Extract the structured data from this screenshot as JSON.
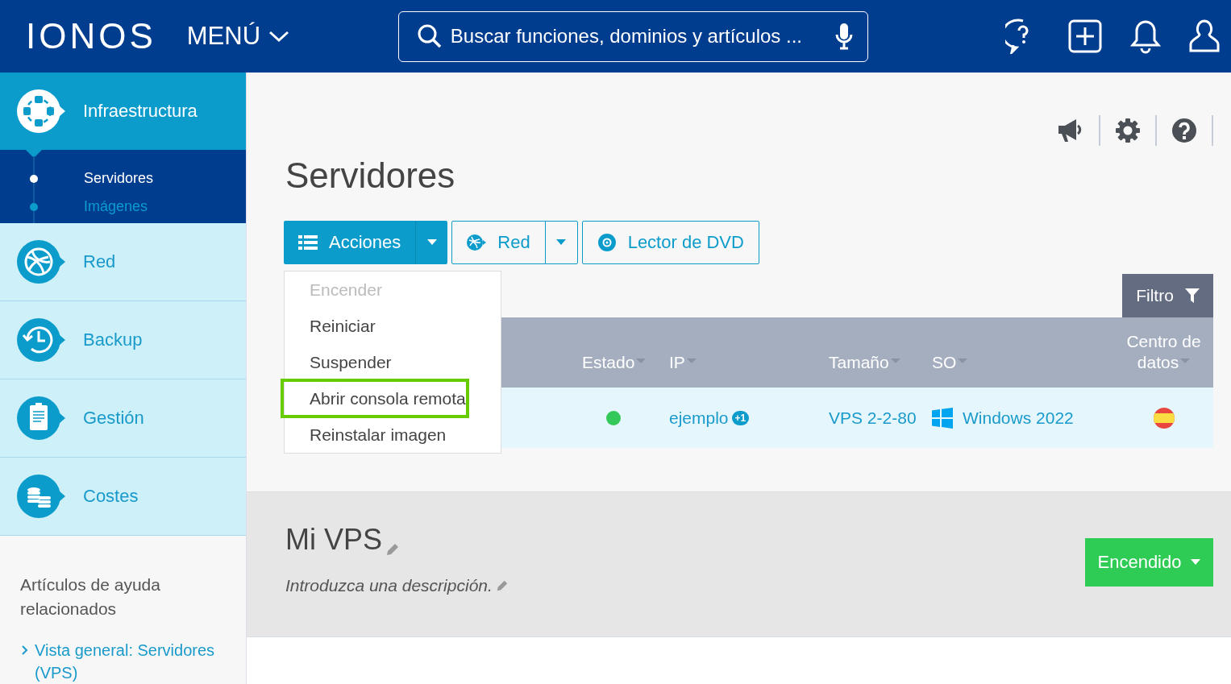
{
  "header": {
    "logo": "IONOS",
    "menu": "MENÚ",
    "search": {
      "placeholder": "Buscar funciones, dominios y artículos ..."
    }
  },
  "sidebar": {
    "items": [
      {
        "label": "Infraestructura",
        "selected": true,
        "children": [
          {
            "label": "Servidores",
            "selected": true
          },
          {
            "label": "Imágenes",
            "selected": false
          }
        ]
      },
      {
        "label": "Red",
        "selected": false
      },
      {
        "label": "Backup",
        "selected": false
      },
      {
        "label": "Gestión",
        "selected": false
      },
      {
        "label": "Costes",
        "selected": false
      }
    ],
    "help": {
      "title": "Artículos de ayuda relacionados",
      "links": [
        "Vista general: Servidores (VPS)"
      ]
    }
  },
  "page": {
    "title": "Servidores",
    "toolbar": [
      {
        "label": "Acciones",
        "kind": "primary",
        "split": true
      },
      {
        "label": "Red",
        "kind": "default",
        "split": true
      },
      {
        "label": "Lector de DVD",
        "kind": "default",
        "split": false
      }
    ],
    "actions_menu": {
      "items": [
        {
          "label": "Encender",
          "disabled": true,
          "highlighted": false
        },
        {
          "label": "Reiniciar",
          "disabled": false,
          "highlighted": false
        },
        {
          "label": "Suspender",
          "disabled": false,
          "highlighted": false
        },
        {
          "label": "Abrir consola remota",
          "disabled": false,
          "highlighted": true
        },
        {
          "label": "Reinstalar imagen",
          "disabled": false,
          "highlighted": false
        }
      ]
    },
    "filter": "Filtro",
    "table": {
      "columns": [
        "Estado",
        "IP",
        "Tamaño",
        "SO",
        "Centro de datos"
      ],
      "rows": [
        {
          "color": "#34c759",
          "ip": "ejemplo",
          "ip_badge": "+1",
          "size": "VPS 2-2-80",
          "os": "Windows 2022"
        }
      ]
    }
  },
  "detail": {
    "title": "Mi VPS",
    "description": "Introduzca una descripción.",
    "power_button": "Encendido"
  }
}
